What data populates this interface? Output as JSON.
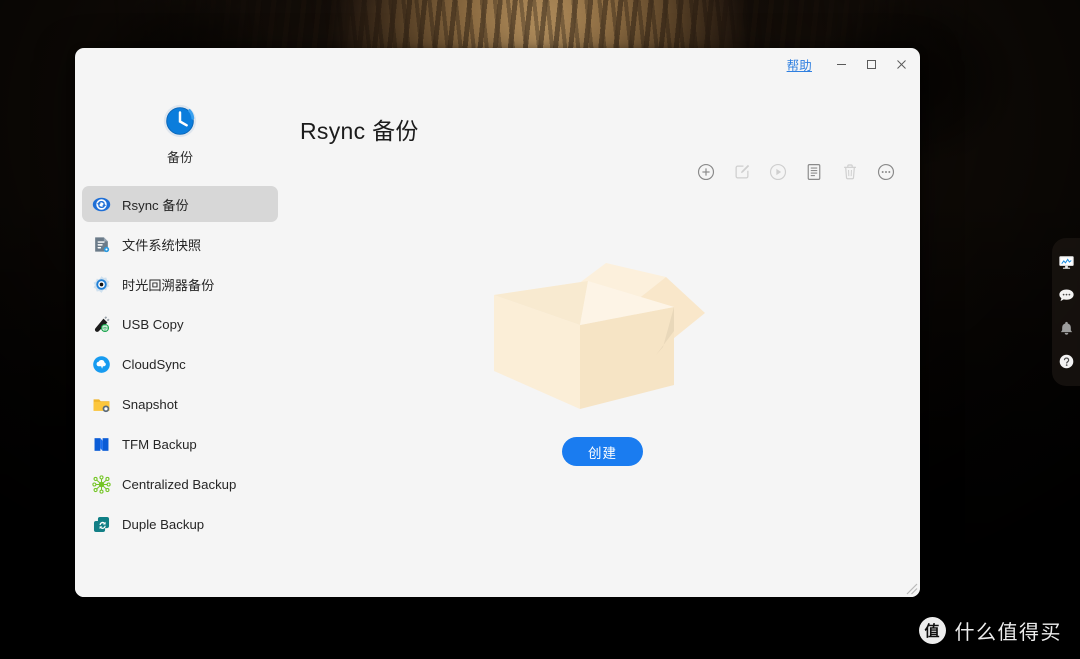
{
  "desktop": {
    "wallpaper_description": "close-up tabby cat face",
    "watermark": {
      "logo_glyph": "值",
      "text": "什么值得买"
    }
  },
  "window": {
    "titlebar": {
      "help_label": "帮助",
      "minimize_label": "最小化",
      "maximize_label": "最大化",
      "close_label": "关闭"
    },
    "brand": {
      "label": "备份",
      "icon": "clock-backup-icon"
    },
    "sidebar": {
      "items": [
        {
          "label": "Rsync 备份",
          "icon": "rsync-icon",
          "selected": true
        },
        {
          "label": "文件系统快照",
          "icon": "filesystem-snapshot-icon",
          "selected": false
        },
        {
          "label": "时光回溯器备份",
          "icon": "time-machine-icon",
          "selected": false
        },
        {
          "label": "USB Copy",
          "icon": "usb-copy-icon",
          "selected": false
        },
        {
          "label": "CloudSync",
          "icon": "cloudsync-icon",
          "selected": false
        },
        {
          "label": "Snapshot",
          "icon": "snapshot-folder-icon",
          "selected": false
        },
        {
          "label": "TFM Backup",
          "icon": "tfm-backup-icon",
          "selected": false
        },
        {
          "label": "Centralized Backup",
          "icon": "centralized-backup-icon",
          "selected": false
        },
        {
          "label": "Duple Backup",
          "icon": "duple-backup-icon",
          "selected": false
        }
      ]
    },
    "main": {
      "page_title": "Rsync 备份",
      "toolbar": [
        {
          "name": "add-task-button",
          "icon": "plus-circle-icon",
          "enabled": true
        },
        {
          "name": "edit-task-button",
          "icon": "edit-pencil-icon",
          "enabled": false
        },
        {
          "name": "run-task-button",
          "icon": "play-circle-icon",
          "enabled": false
        },
        {
          "name": "view-log-button",
          "icon": "log-document-icon",
          "enabled": true
        },
        {
          "name": "delete-task-button",
          "icon": "trash-icon",
          "enabled": false
        },
        {
          "name": "more-options-button",
          "icon": "ellipsis-circle-icon",
          "enabled": true
        }
      ],
      "empty_state": {
        "illustration": "open-cardboard-box-icon",
        "create_button_label": "创建"
      }
    }
  },
  "dock": {
    "items": [
      {
        "name": "resource-monitor-icon",
        "label": "资源监控"
      },
      {
        "name": "chat-bubble-icon",
        "label": "聊天"
      },
      {
        "name": "notification-bell-icon",
        "label": "通知"
      },
      {
        "name": "help-question-icon",
        "label": "帮助"
      }
    ]
  },
  "colors": {
    "accent": "#1a7cf0",
    "window_bg": "#f5f5f5",
    "selected_item": "#d7d7d7",
    "box_light": "#fbedd6",
    "box_mid": "#f6e2c4",
    "box_shadow": "#e9d5b4"
  }
}
